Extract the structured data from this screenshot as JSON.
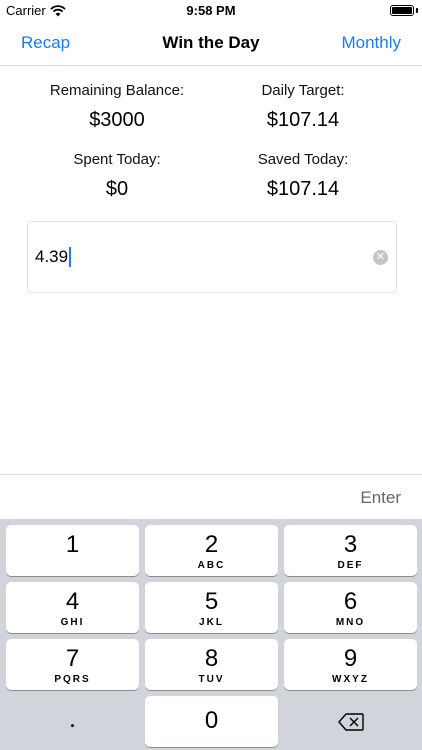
{
  "status_bar": {
    "carrier": "Carrier",
    "time": "9:58 PM"
  },
  "nav": {
    "left_button": "Recap",
    "title": "Win the Day",
    "right_button": "Monthly"
  },
  "stats": {
    "remaining_balance": {
      "label": "Remaining Balance:",
      "value": "$3000"
    },
    "daily_target": {
      "label": "Daily Target:",
      "value": "$107.14"
    },
    "spent_today": {
      "label": "Spent Today:",
      "value": "$0"
    },
    "saved_today": {
      "label": "Saved Today:",
      "value": "$107.14"
    }
  },
  "amount_input": {
    "value": "4.39"
  },
  "accessory": {
    "enter_label": "Enter"
  },
  "keypad": {
    "keys": [
      {
        "digit": "1",
        "letters": ""
      },
      {
        "digit": "2",
        "letters": "ABC"
      },
      {
        "digit": "3",
        "letters": "DEF"
      },
      {
        "digit": "4",
        "letters": "GHI"
      },
      {
        "digit": "5",
        "letters": "JKL"
      },
      {
        "digit": "6",
        "letters": "MNO"
      },
      {
        "digit": "7",
        "letters": "PQRS"
      },
      {
        "digit": "8",
        "letters": "TUV"
      },
      {
        "digit": "9",
        "letters": "WXYZ"
      }
    ],
    "decimal": ".",
    "zero": "0"
  },
  "colors": {
    "accent": "#1a7ee8",
    "keyboard_bg": "#d1d4da",
    "enter_text": "#666666"
  },
  "icons": [
    "wifi-icon",
    "battery-icon",
    "clear-icon",
    "backspace-icon"
  ]
}
